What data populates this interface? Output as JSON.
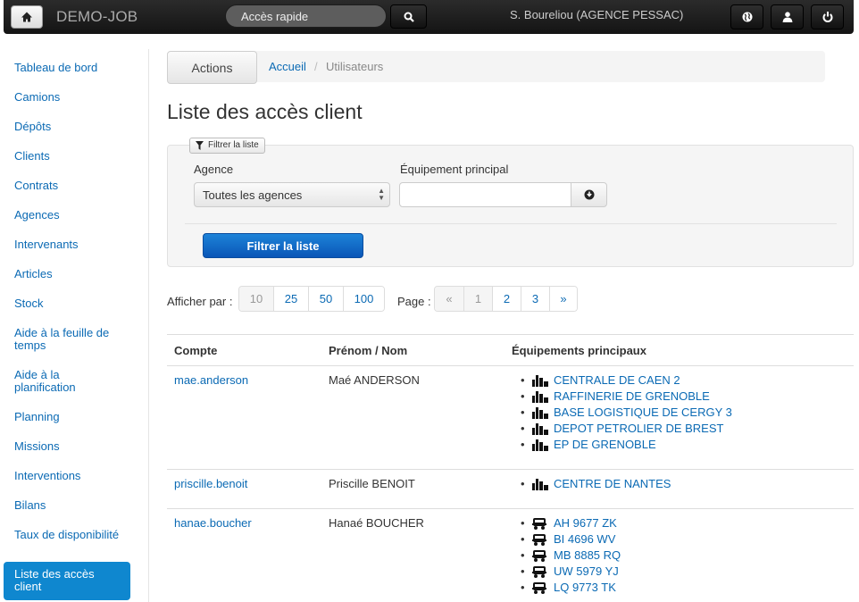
{
  "navbar": {
    "brand": "DEMO-JOB",
    "search_placeholder": "Accès rapide",
    "user": "S. Boureliou (AGENCE PESSAC)"
  },
  "sidebar": {
    "items": [
      "Tableau de bord",
      "Camions",
      "Dépôts",
      "Clients",
      "Contrats",
      "Agences",
      "Intervenants",
      "Articles",
      "Stock",
      "Aide à la feuille de temps",
      "Aide à la planification",
      "Planning",
      "Missions",
      "Interventions",
      "Bilans",
      "Taux de disponibilité",
      "Liste des accès client"
    ],
    "active_index": 16
  },
  "breadcrumb": {
    "actions_label": "Actions",
    "home": "Accueil",
    "separator": "/",
    "current": "Utilisateurs"
  },
  "page_title": "Liste des accès client",
  "filter": {
    "tag_label": "Filtrer la liste",
    "agence_label": "Agence",
    "agence_value": "Toutes les agences",
    "equip_label": "Équipement principal",
    "equip_value": "",
    "submit_label": "Filtrer la liste"
  },
  "pagination": {
    "per_page_label": "Afficher par :",
    "per_page_options": [
      "10",
      "25",
      "50",
      "100"
    ],
    "per_page_selected": "10",
    "page_label": "Page :",
    "pages": [
      "«",
      "1",
      "2",
      "3",
      "»"
    ],
    "current_page": "1"
  },
  "table": {
    "headers": [
      "Compte",
      "Prénom / Nom",
      "Équipements principaux"
    ],
    "rows": [
      {
        "account": "mae.anderson",
        "name": "Maé ANDERSON",
        "icon": "factory-icon",
        "equipments": [
          "CENTRALE DE CAEN 2",
          "RAFFINERIE DE GRENOBLE",
          "BASE LOGISTIQUE DE CERGY 3",
          "DEPOT PETROLIER DE BREST",
          "EP DE GRENOBLE"
        ]
      },
      {
        "account": "priscille.benoit",
        "name": "Priscille BENOIT",
        "icon": "factory-icon",
        "equipments": [
          "CENTRE DE NANTES"
        ]
      },
      {
        "account": "hanae.boucher",
        "name": "Hanaé BOUCHER",
        "icon": "truck-icon",
        "equipments": [
          "AH 9677 ZK",
          "BI 4696 WV",
          "MB 8885 RQ",
          "UW 5979 YJ",
          "LQ 9773 TK"
        ]
      }
    ]
  },
  "colors": {
    "link": "#0b6ab4",
    "active": "#0f87cf",
    "primary_button": "#0a56b7"
  }
}
